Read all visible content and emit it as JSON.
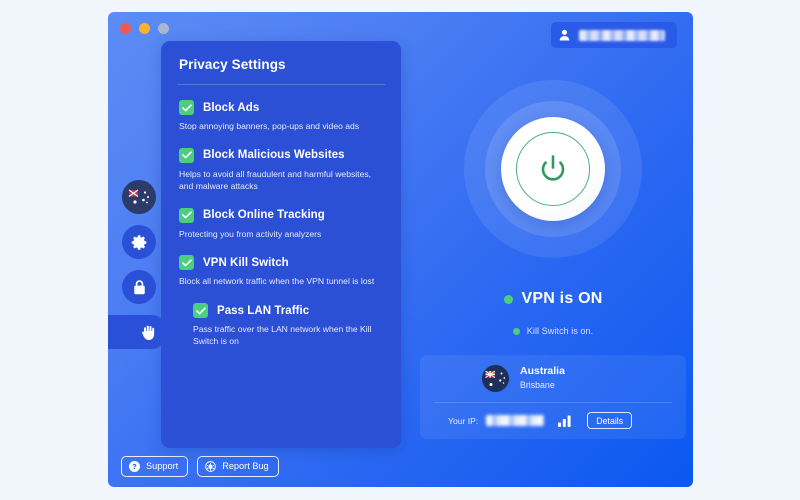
{
  "window": {
    "traffic_lights": [
      "close",
      "minimize",
      "maximize"
    ],
    "account": {
      "icon": "person-icon",
      "name_redacted": true,
      "name": ""
    }
  },
  "sidebar": {
    "items": [
      {
        "icon": "globe-location-icon",
        "name": "location",
        "active": false
      },
      {
        "icon": "gear-icon",
        "name": "settings",
        "active": false
      },
      {
        "icon": "lock-icon",
        "name": "security",
        "active": false
      },
      {
        "icon": "hand-icon",
        "name": "privacy",
        "active": true
      }
    ]
  },
  "settings_panel": {
    "title": "Privacy Settings",
    "items": [
      {
        "label": "Block Ads",
        "description": "Stop annoying banners, pop-ups and video ads",
        "checked": true,
        "indented": false
      },
      {
        "label": "Block Malicious Websites",
        "description": "Helps to avoid all fraudulent and harmful websites, and malware attacks",
        "checked": true,
        "indented": false
      },
      {
        "label": "Block Online Tracking",
        "description": "Protecting you from activity analyzers",
        "checked": true,
        "indented": false
      },
      {
        "label": "VPN Kill Switch",
        "description": "Block all network traffic when the VPN tunnel is lost",
        "checked": true,
        "indented": false
      },
      {
        "label": "Pass LAN Traffic",
        "description": "Pass traffic over the LAN network when the Kill Switch is on",
        "checked": true,
        "indented": true
      }
    ]
  },
  "connection": {
    "power_button": {
      "icon": "power-icon",
      "state": "on"
    },
    "status_text": "VPN is ON",
    "status_dot_color": "#4ccf7d",
    "killswitch_text": "Kill Switch is on.",
    "killswitch_dot_color": "#4ccf7d",
    "server": {
      "flag_icon": "australia-flag-icon",
      "country": "Australia",
      "city": "Brisbane"
    },
    "ip": {
      "label": "Your IP:",
      "value_redacted": true,
      "value": "",
      "signal_icon": "signal-bars-icon"
    },
    "details_label": "Details"
  },
  "bottom_bar": {
    "support": {
      "label": "Support",
      "icon": "question-circle-icon"
    },
    "report_bug": {
      "label": "Report Bug",
      "icon": "bug-circle-icon"
    }
  },
  "colors": {
    "accent_green": "#4ccf7d",
    "panel_blue": "#2b50d6",
    "window_blue": "#0b58f0",
    "page_background": "#f1f5fc"
  }
}
